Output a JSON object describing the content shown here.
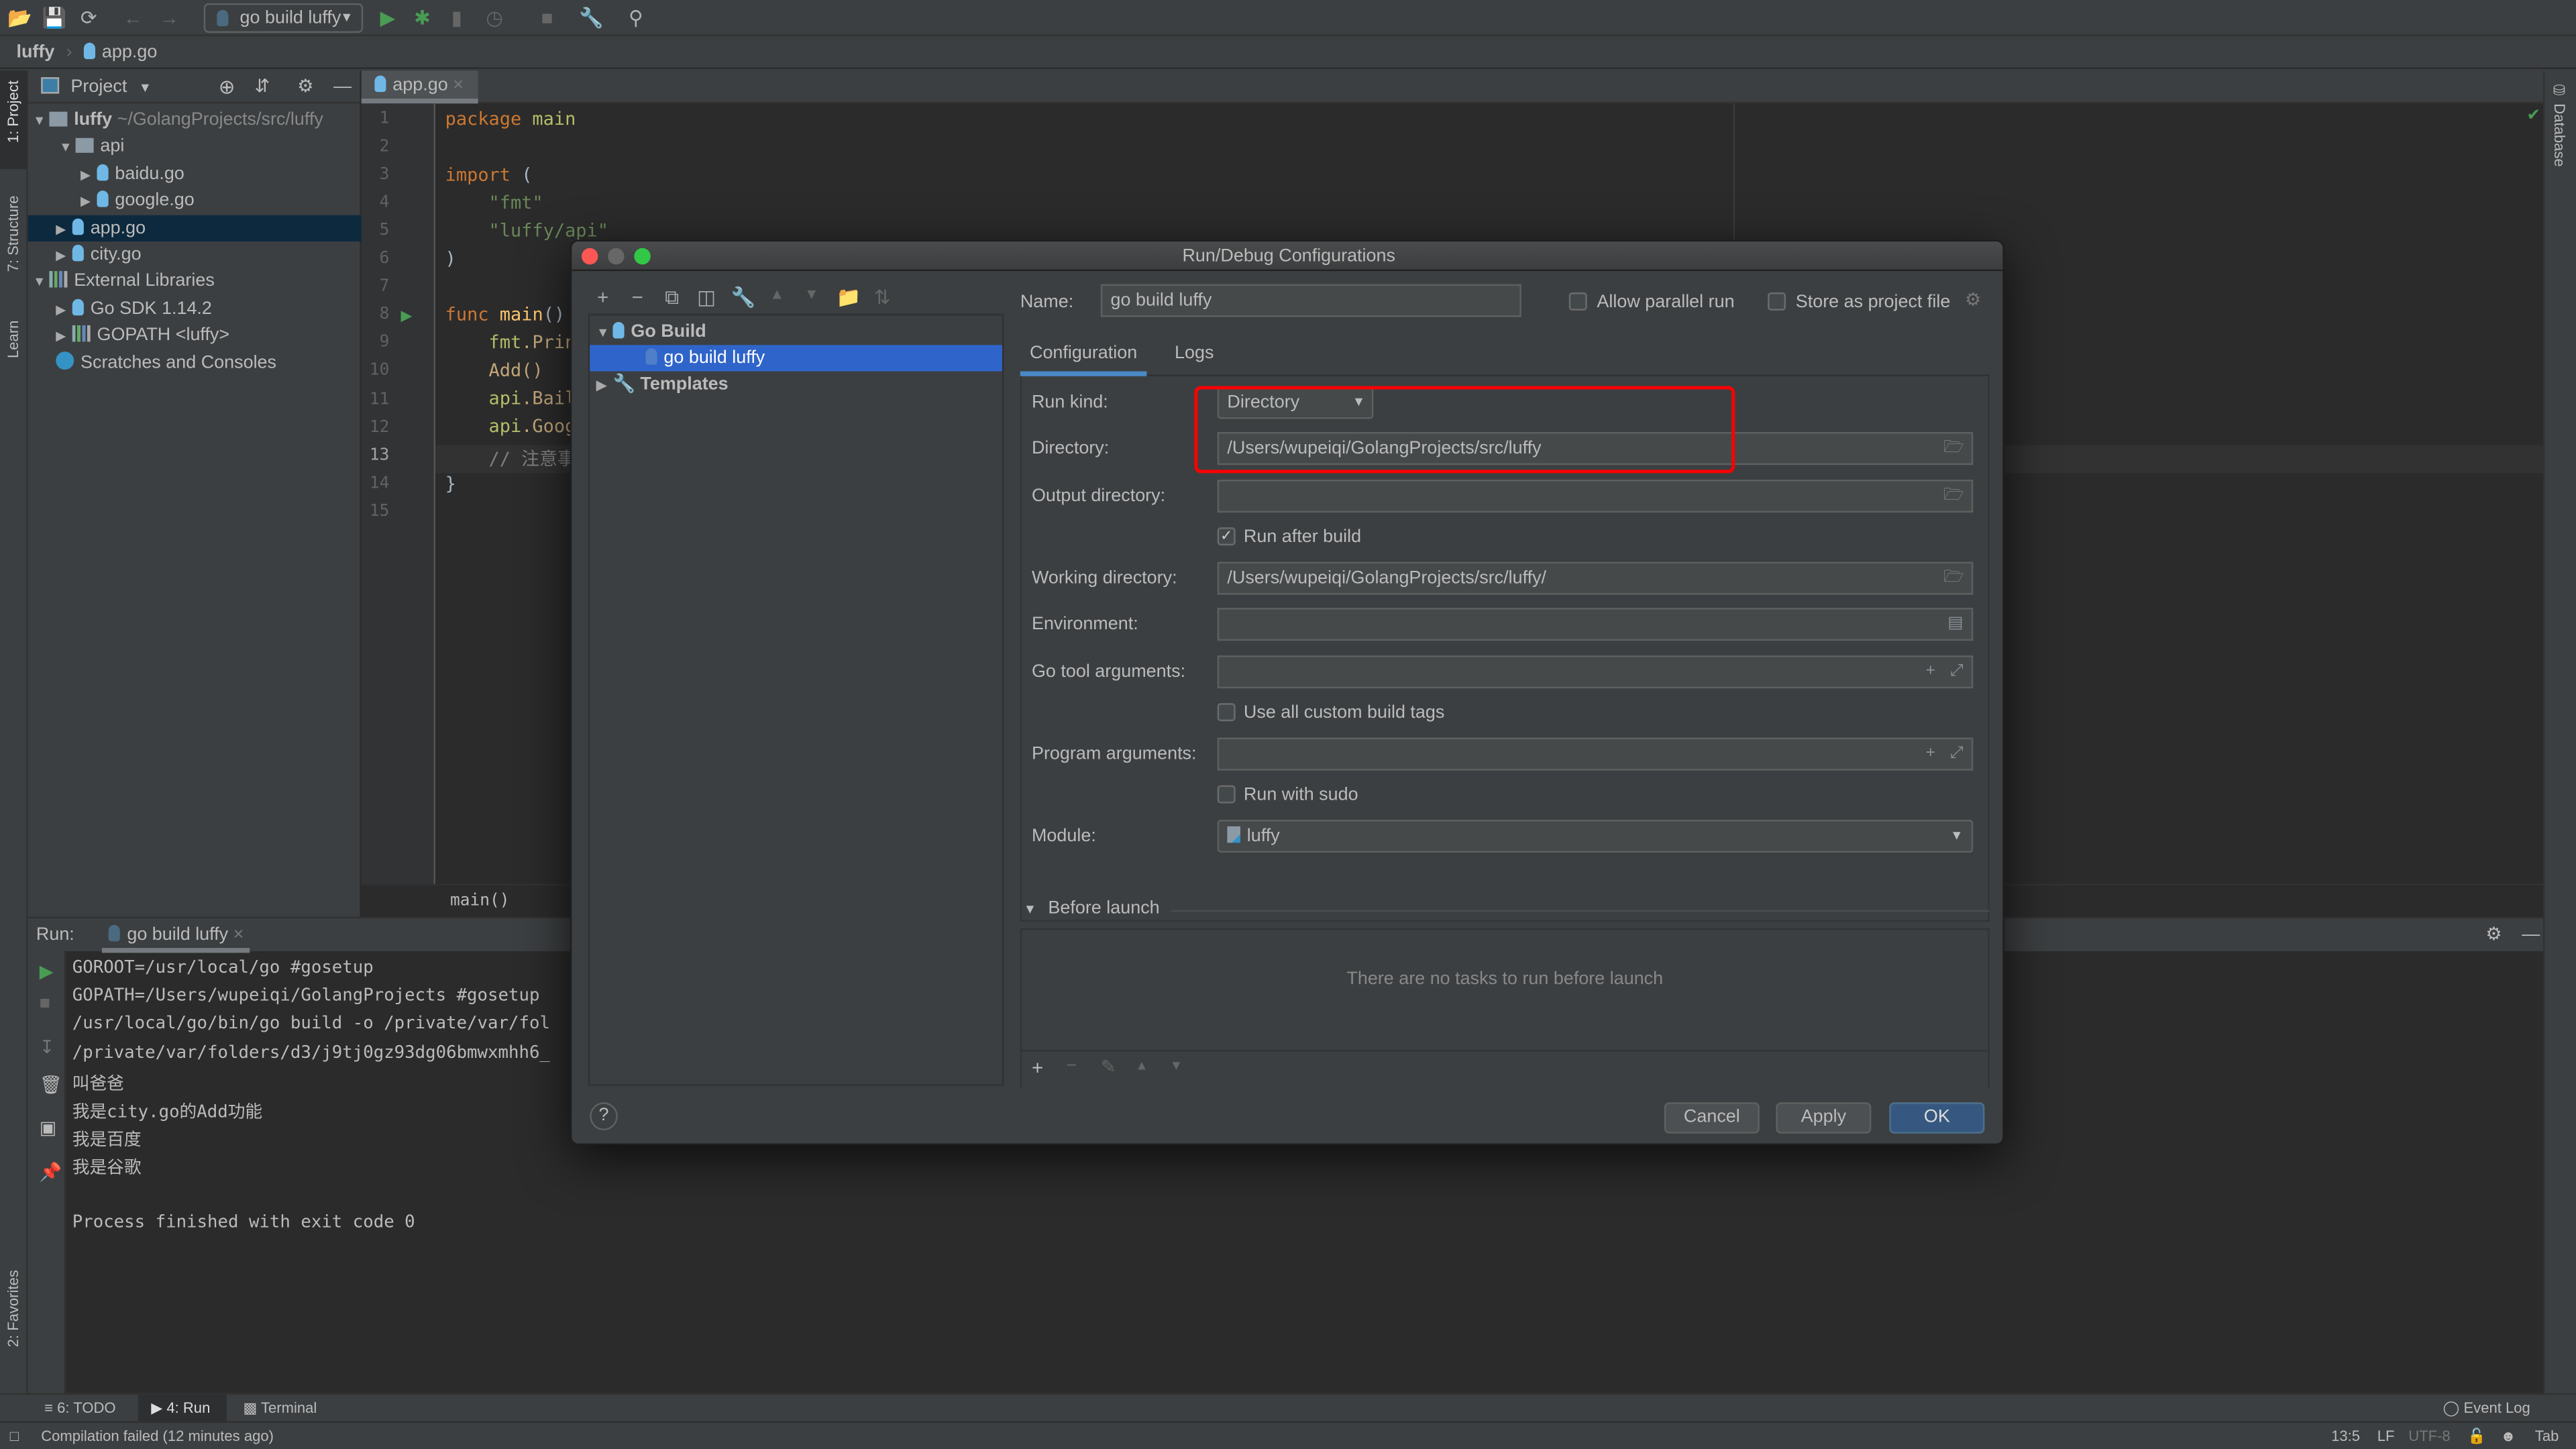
{
  "toolbar": {
    "run_config": "go build luffy"
  },
  "breadcrumb": {
    "project": "luffy",
    "file": "app.go"
  },
  "left_strip": {
    "project": "1: Project",
    "structure": "7: Structure",
    "learn": "Learn",
    "favorites": "2: Favorites"
  },
  "right_strip": {
    "database": "Database"
  },
  "project_panel": {
    "title": "Project",
    "tree": [
      {
        "label": "luffy",
        "hint": "~/GolangProjects/src/luffy"
      },
      {
        "label": "api"
      },
      {
        "label": "baidu.go"
      },
      {
        "label": "google.go"
      },
      {
        "label": "app.go"
      },
      {
        "label": "city.go"
      },
      {
        "label": "External Libraries"
      },
      {
        "label": "Go SDK 1.14.2"
      },
      {
        "label": "GOPATH <luffy>"
      },
      {
        "label": "Scratches and Consoles"
      }
    ]
  },
  "editor": {
    "tab": "app.go",
    "lines": [
      "1",
      "2",
      "3",
      "4",
      "5",
      "6",
      "7",
      "8",
      "9",
      "10",
      "11",
      "12",
      "13",
      "14",
      "15"
    ],
    "code": {
      "l1a": "package",
      "l1b": " main",
      "l3a": "import",
      "l3b": " (",
      "l4": "    \"fmt\"",
      "l5": "    \"luffy/api\"",
      "l6": ")",
      "l8a": "func",
      "l8b": " main",
      "l8c": "()",
      "l9a": "    fmt",
      "l9b": ".Prin",
      "l10": "    Add()",
      "l11a": "    api",
      "l11b": ".Bail",
      "l12a": "    api",
      "l12b": ".Goog",
      "l13": "    // 注意事",
      "l14": "}"
    },
    "breadcrumb": "main()"
  },
  "run_panel": {
    "label": "Run:",
    "tab": "go build luffy",
    "output": [
      "GOROOT=/usr/local/go #gosetup",
      "GOPATH=/Users/wupeiqi/GolangProjects #gosetup",
      "/usr/local/go/bin/go build -o /private/var/fol",
      "/private/var/folders/d3/j9tj0gz93dg06bmwxmhh6_",
      "叫爸爸",
      "我是city.go的Add功能",
      "我是百度",
      "我是谷歌",
      "",
      "Process finished with exit code 0"
    ]
  },
  "bottom_tabs": {
    "todo": "6: TODO",
    "run": "4: Run",
    "terminal": "Terminal",
    "event_log": "Event Log"
  },
  "status_bar": {
    "message": "Compilation failed (12 minutes ago)",
    "position": "13:5",
    "line_sep": "LF",
    "encoding": "UTF-8",
    "indent": "Tab"
  },
  "dialog": {
    "title": "Run/Debug Configurations",
    "tree": {
      "group": "Go Build",
      "item": "go build luffy",
      "templates": "Templates"
    },
    "name_label": "Name:",
    "name_value": "go build luffy",
    "allow_parallel": {
      "label": "Allow parallel run",
      "checked": false
    },
    "store_project": {
      "label": "Store as project file",
      "checked": false
    },
    "tabs": [
      "Configuration",
      "Logs"
    ],
    "active_tab": "Configuration",
    "form": {
      "run_kind_label": "Run kind:",
      "run_kind_value": "Directory",
      "directory_label": "Directory:",
      "directory_value": "/Users/wupeiqi/GolangProjects/src/luffy",
      "output_dir_label": "Output directory:",
      "output_dir_value": "",
      "run_after_build": {
        "label": "Run after build",
        "checked": true
      },
      "working_dir_label": "Working directory:",
      "working_dir_value": "/Users/wupeiqi/GolangProjects/src/luffy/",
      "environment_label": "Environment:",
      "environment_value": "",
      "go_tool_args_label": "Go tool arguments:",
      "go_tool_args_value": "",
      "custom_tags": {
        "label": "Use all custom build tags",
        "checked": false
      },
      "program_args_label": "Program arguments:",
      "program_args_value": "",
      "sudo": {
        "label": "Run with sudo",
        "checked": false
      },
      "module_label": "Module:",
      "module_value": "luffy"
    },
    "before_launch": {
      "title": "Before launch",
      "empty": "There are no tasks to run before launch"
    },
    "buttons": {
      "cancel": "Cancel",
      "apply": "Apply",
      "ok": "OK",
      "help": "?"
    },
    "highlight_color": "#ff0000"
  },
  "colors": {
    "selection": "#2f65ca",
    "ok_button": "#365880",
    "run_green": "#499c54"
  }
}
